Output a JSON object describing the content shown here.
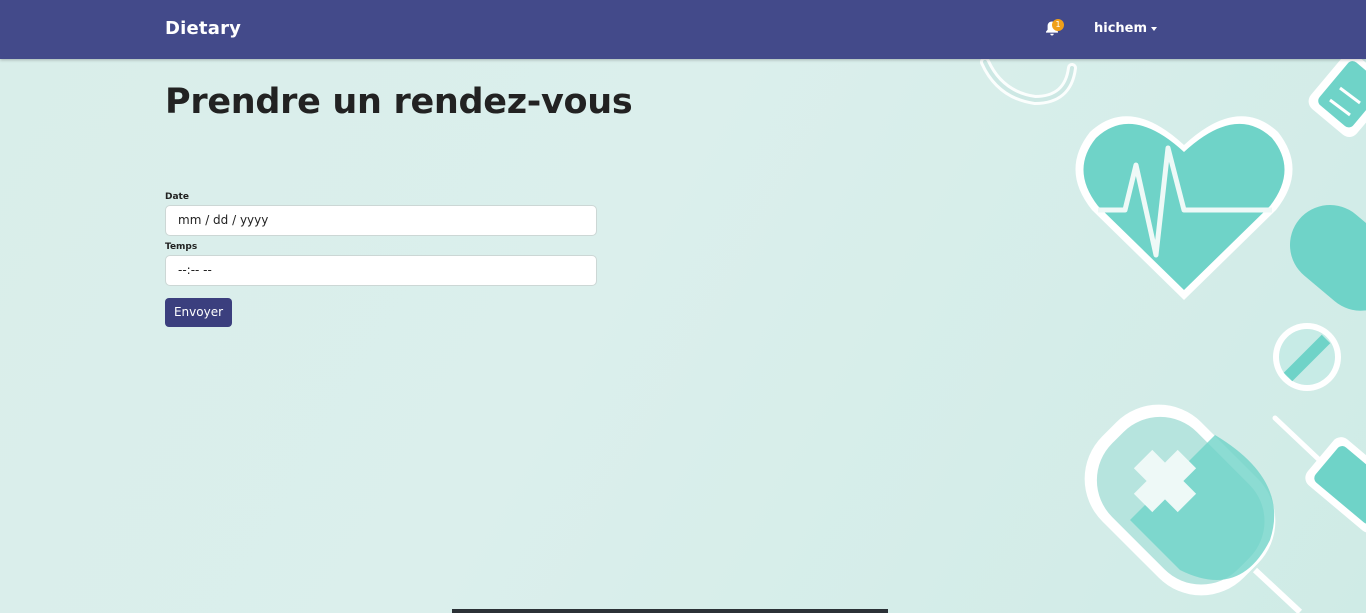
{
  "navbar": {
    "brand": "Dietary",
    "notifications_count": "1",
    "user_name": "hichem"
  },
  "page": {
    "title": "Prendre un rendez-vous"
  },
  "form": {
    "date_label": "Date",
    "date_value": "mm / dd / yyyy",
    "time_label": "Temps",
    "time_value": "--:-- --",
    "submit_label": "Envoyer"
  },
  "icons": {
    "notification": "bell-icon",
    "user_menu": "caret-down-icon"
  },
  "colors": {
    "navbar": "#434a8a",
    "button": "#3b3f7e",
    "badge": "#f0a019",
    "background": "#d9eeea",
    "accent": "#6fd3c8"
  }
}
